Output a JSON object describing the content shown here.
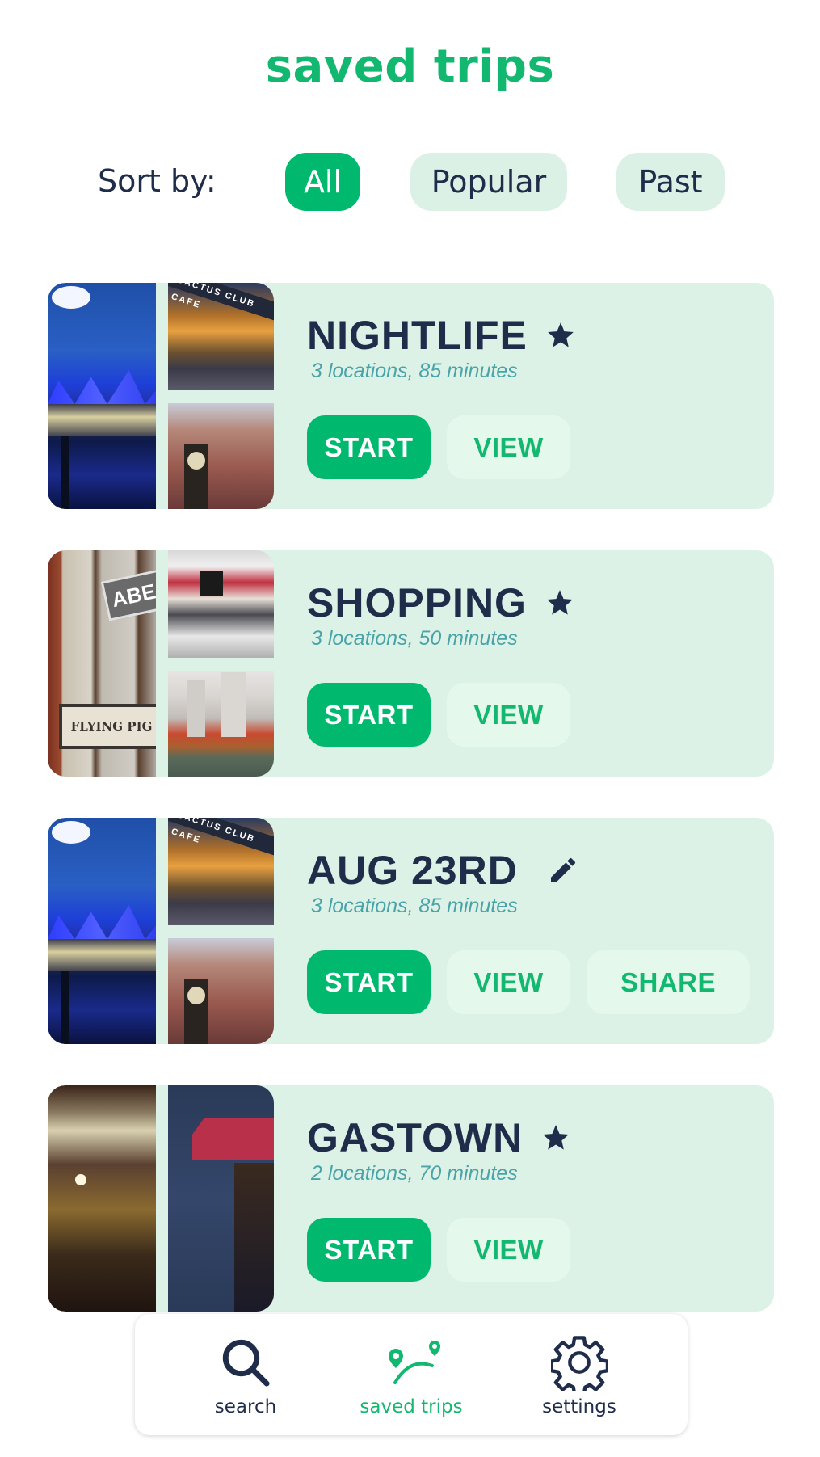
{
  "header": {
    "title": "saved trips"
  },
  "sort": {
    "label": "Sort by:",
    "options": [
      {
        "label": "All",
        "active": true
      },
      {
        "label": "Popular",
        "active": false
      },
      {
        "label": "Past",
        "active": false
      }
    ]
  },
  "trips": [
    {
      "title": "NIGHTLIFE",
      "title_icon": "star-icon",
      "subtitle": "3 locations, 85 minutes",
      "images": [
        "canada-place-night",
        "cactus-club-cafe",
        "gastown-steam-clock"
      ],
      "buttons": {
        "start": "START",
        "view": "VIEW"
      }
    },
    {
      "title": "SHOPPING",
      "title_icon": "star-icon",
      "subtitle": "3 locations, 50 minutes",
      "images": [
        "flying-pig-gastown",
        "miniso-store",
        "park-towers-autumn"
      ],
      "buttons": {
        "start": "START",
        "view": "VIEW"
      }
    },
    {
      "title": "AUG 23RD",
      "title_icon": "pencil-icon",
      "subtitle": "3 locations, 85 minutes",
      "images": [
        "canada-place-night",
        "cactus-club-cafe",
        "gastown-steam-clock"
      ],
      "buttons": {
        "start": "START",
        "view": "VIEW",
        "share": "SHARE"
      }
    },
    {
      "title": "GASTOWN",
      "title_icon": "star-icon",
      "subtitle": "2 locations, 70 minutes",
      "images": [
        "old-spaghetti-factory",
        "angel-awning"
      ],
      "buttons": {
        "start": "START",
        "view": "VIEW"
      }
    }
  ],
  "nav": {
    "items": [
      {
        "label": "search",
        "icon": "search-icon",
        "active": false
      },
      {
        "label": "saved trips",
        "icon": "route-pins-icon",
        "active": true
      },
      {
        "label": "settings",
        "icon": "gear-icon",
        "active": false
      }
    ]
  },
  "colors": {
    "accent": "#00b96f",
    "card_bg": "#ddf2e6",
    "text_dark": "#1f2d4a",
    "subtitle": "#4aa3a8"
  }
}
